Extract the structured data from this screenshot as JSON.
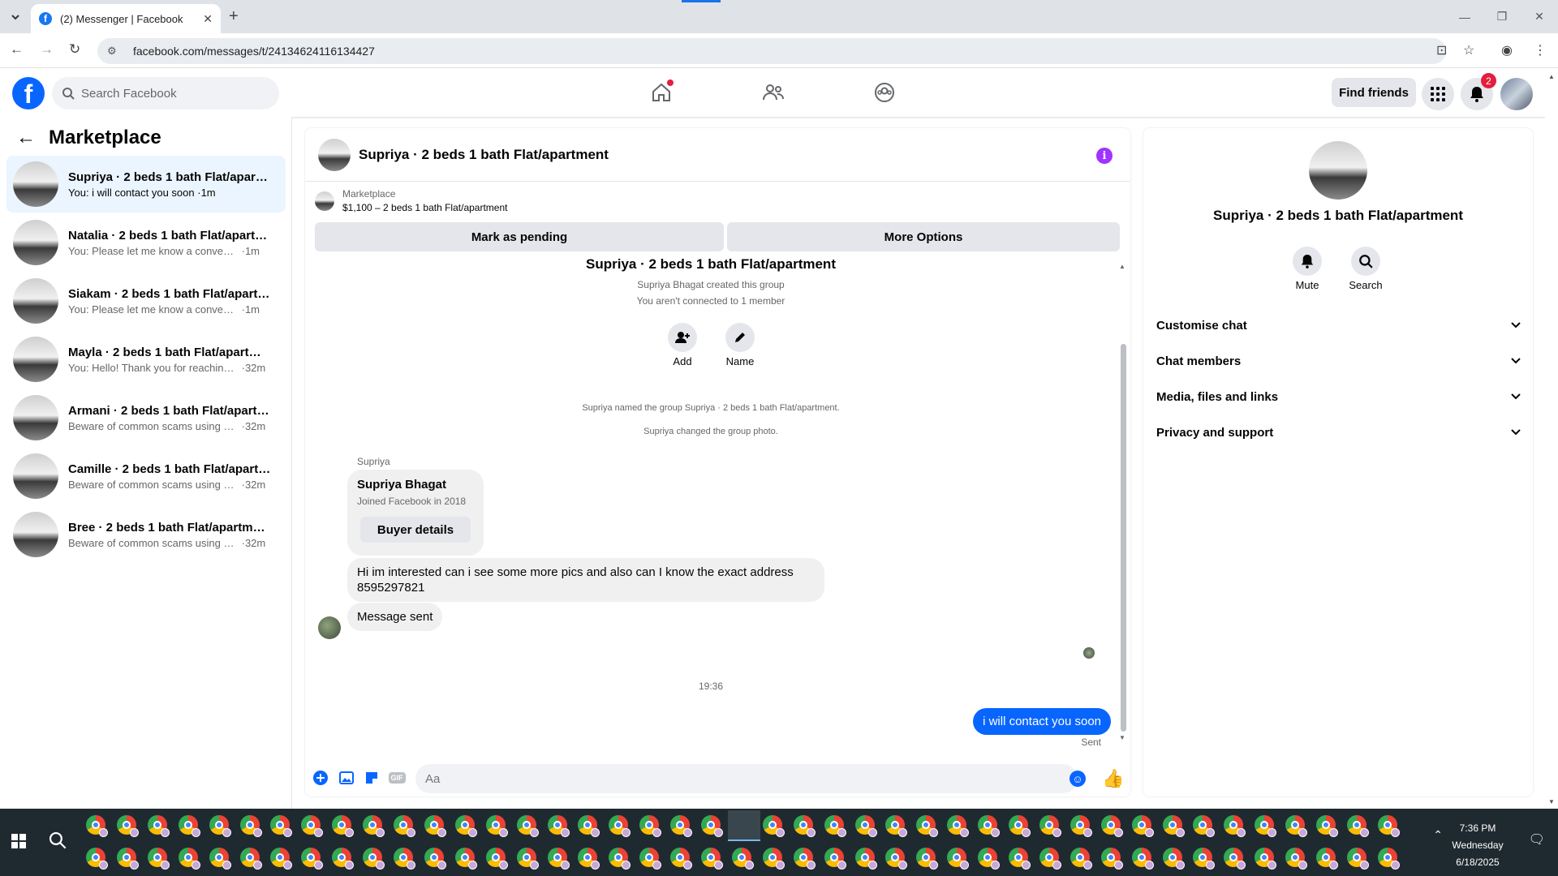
{
  "browser": {
    "tab_title": "(2) Messenger | Facebook",
    "url": "facebook.com/messages/t/24134624116134427"
  },
  "fb": {
    "search_placeholder": "Search Facebook",
    "find_friends": "Find friends",
    "notification_count": "2"
  },
  "left": {
    "title": "Marketplace",
    "conversations": [
      {
        "name": "Supriya · 2 beds 1 bath Flat/apartment",
        "preview": "You: i will contact you soon",
        "time": "1m",
        "active": true
      },
      {
        "name": "Natalia · 2 beds 1 bath Flat/apartment",
        "preview": "You: Please let me know a convenient...",
        "time": "1m"
      },
      {
        "name": "Siakam · 2 beds 1 bath Flat/apartment",
        "preview": "You: Please let me know a convenient...",
        "time": "1m"
      },
      {
        "name": "Mayla · 2 beds 1 bath Flat/apartment",
        "preview": "You: Hello! Thank you for reaching o...",
        "time": "32m"
      },
      {
        "name": "Armani · 2 beds 1 bath Flat/apartment",
        "preview": "Beware of common scams using pa...",
        "time": "32m"
      },
      {
        "name": "Camille · 2 beds 1 bath Flat/apartment",
        "preview": "Beware of common scams using pa...",
        "time": "32m"
      },
      {
        "name": "Bree · 2 beds 1 bath Flat/apartment",
        "preview": "Beware of common scams using pa...",
        "time": "32m"
      }
    ]
  },
  "chat": {
    "title": "Supriya · 2 beds 1 bath Flat/apartment",
    "marketplace_label": "Marketplace",
    "listing": "$1,100 – 2 beds 1 bath Flat/apartment",
    "mark_pending": "Mark as pending",
    "more_options": "More Options",
    "group_title": "Supriya · 2 beds 1 bath Flat/apartment",
    "created": "Supriya Bhagat created this group",
    "not_connected": "You aren't connected to 1 member",
    "add_label": "Add",
    "name_label": "Name",
    "named_event": "Supriya named the group Supriya · 2 beds 1 bath Flat/apartment.",
    "photo_event": "Supriya changed the group photo.",
    "sender": "Supriya",
    "card_name": "Supriya Bhagat",
    "card_joined": "Joined Facebook in 2018",
    "buyer_details": "Buyer details",
    "msg1_line1": "Hi im interested can i see some more pics and also can I know the exact address",
    "msg1_line2": "8595297821",
    "msg2": "Message sent",
    "time": "19:36",
    "my_msg": "i will contact you soon",
    "sent": "Sent",
    "input_placeholder": "Aa",
    "gif": "GIF"
  },
  "right": {
    "name": "Supriya · 2 beds 1 bath Flat/apartment",
    "mute": "Mute",
    "search": "Search",
    "sections": [
      "Customise chat",
      "Chat members",
      "Media, files and links",
      "Privacy and support"
    ]
  },
  "taskbar": {
    "time": "7:36 PM",
    "day": "Wednesday",
    "date": "6/18/2025"
  },
  "colors": {
    "fb_blue": "#0866ff",
    "active_conv": "#ebf5ff",
    "info_purple": "#a033ff",
    "badge_red": "#e41e3f"
  }
}
